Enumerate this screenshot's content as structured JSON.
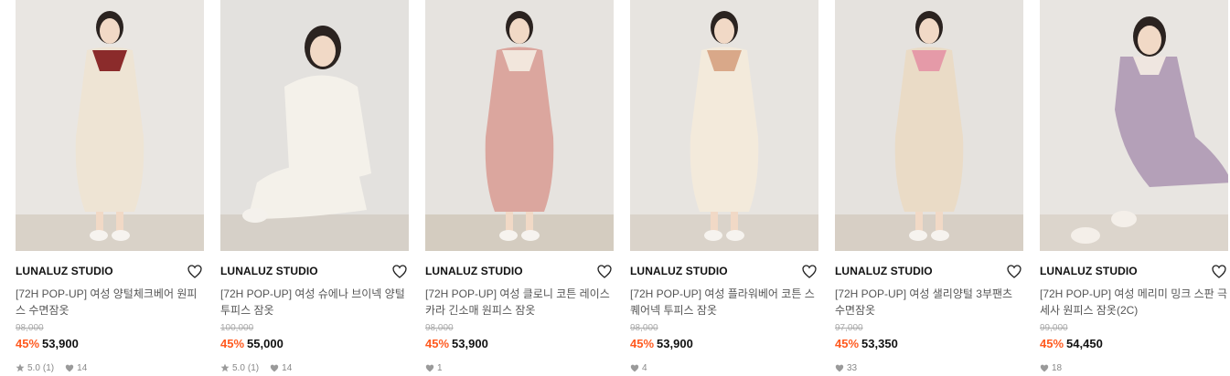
{
  "products": [
    {
      "brand": "LUNALUZ STUDIO",
      "title": "[72H POP-UP] 여성 양털체크베어 원피스 수면잠옷",
      "original_price": "98,000",
      "discount": "45%",
      "price": "53,900",
      "rating": "5.0",
      "review_count": "(1)",
      "likes": "14",
      "outfit_color": "#eee4d4",
      "accent_color": "#8b2b2b"
    },
    {
      "brand": "LUNALUZ STUDIO",
      "title": "[72H POP-UP] 여성 슈에나 브이넥 양털 투피스 잠옷",
      "original_price": "100,000",
      "discount": "45%",
      "price": "55,000",
      "rating": "5.0",
      "review_count": "(1)",
      "likes": "14",
      "outfit_color": "#f4f1ea",
      "accent_color": "#e6e0d6"
    },
    {
      "brand": "LUNALUZ STUDIO",
      "title": "[72H POP-UP] 여성 클로니 코튼 레이스카라 긴소매 원피스 잠옷",
      "original_price": "98,000",
      "discount": "45%",
      "price": "53,900",
      "rating": "",
      "review_count": "",
      "likes": "1",
      "outfit_color": "#dba69e",
      "accent_color": "#f2e6dc"
    },
    {
      "brand": "LUNALUZ STUDIO",
      "title": "[72H POP-UP] 여성 플라워베어 코튼 스퀘어넥 투피스 잠옷",
      "original_price": "98,000",
      "discount": "45%",
      "price": "53,900",
      "rating": "",
      "review_count": "",
      "likes": "4",
      "outfit_color": "#f3eadb",
      "accent_color": "#d9a889"
    },
    {
      "brand": "LUNALUZ STUDIO",
      "title": "[72H POP-UP] 여성 샐리양털 3부팬츠 수면잠옷",
      "original_price": "97,000",
      "discount": "45%",
      "price": "53,350",
      "rating": "",
      "review_count": "",
      "likes": "33",
      "outfit_color": "#eadbc6",
      "accent_color": "#e59aa8"
    },
    {
      "brand": "LUNALUZ STUDIO",
      "title": "[72H POP-UP] 여성 메리미 밍크 스판 극세사 원피스 잠옷(2C)",
      "original_price": "99,000",
      "discount": "45%",
      "price": "54,450",
      "rating": "",
      "review_count": "",
      "likes": "18",
      "outfit_color": "#b4a0b8",
      "accent_color": "#efe6e0"
    }
  ]
}
